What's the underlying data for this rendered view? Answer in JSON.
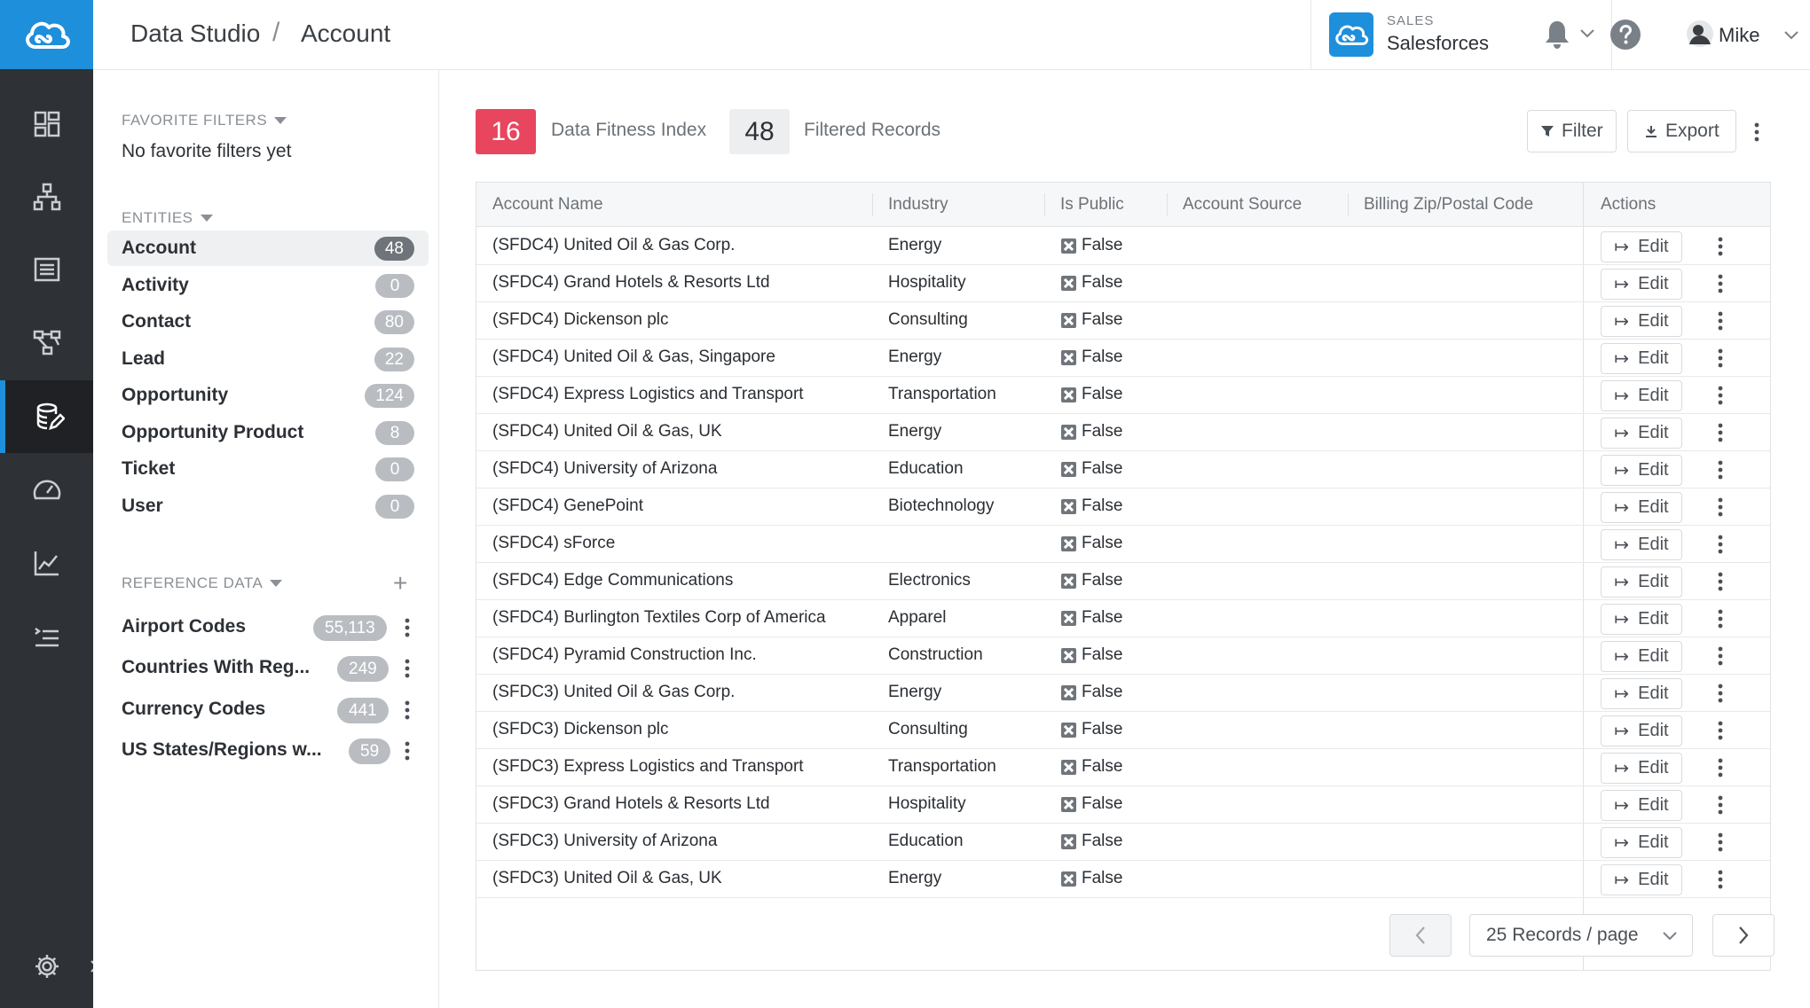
{
  "topbar": {
    "breadcrumb": [
      "Data Studio",
      "Account"
    ],
    "breadcrumb_separator": "/",
    "source": {
      "category": "SALES",
      "name": "Salesforces"
    },
    "user": {
      "name": "Mike"
    }
  },
  "rail": {
    "items": [
      "dashboard-icon",
      "hierarchy-icon",
      "list-icon",
      "flow-icon",
      "data-studio-icon",
      "gauge-icon",
      "chart-icon",
      "tasks-icon"
    ],
    "active": "data-studio-icon"
  },
  "sidebar": {
    "favorite_title": "FAVORITE FILTERS",
    "no_favorites": "No favorite filters yet",
    "entities_title": "ENTITIES",
    "entities": [
      {
        "label": "Account",
        "count": "48"
      },
      {
        "label": "Activity",
        "count": "0"
      },
      {
        "label": "Contact",
        "count": "80"
      },
      {
        "label": "Lead",
        "count": "22"
      },
      {
        "label": "Opportunity",
        "count": "124"
      },
      {
        "label": "Opportunity Product",
        "count": "8"
      },
      {
        "label": "Ticket",
        "count": "0"
      },
      {
        "label": "User",
        "count": "0"
      }
    ],
    "reference_title": "REFERENCE DATA",
    "reference": [
      {
        "label": "Airport Codes",
        "count": "55,113"
      },
      {
        "label": "Countries With Reg...",
        "count": "249"
      },
      {
        "label": "Currency Codes",
        "count": "441"
      },
      {
        "label": "US States/Regions w...",
        "count": "59"
      }
    ]
  },
  "main": {
    "fitness_value": "16",
    "fitness_label": "Data Fitness Index",
    "filtered_value": "48",
    "filtered_label": "Filtered Records",
    "filter_button": "Filter",
    "export_button": "Export",
    "columns": [
      "Account Name",
      "Industry",
      "Is Public",
      "Account Source",
      "Billing Zip/Postal Code",
      "Actions"
    ],
    "edit_label": "Edit",
    "rows": [
      {
        "name": "(SFDC4) United Oil & Gas Corp.",
        "industry": "Energy",
        "is_public": "False"
      },
      {
        "name": "(SFDC4) Grand Hotels & Resorts Ltd",
        "industry": "Hospitality",
        "is_public": "False"
      },
      {
        "name": "(SFDC4) Dickenson plc",
        "industry": "Consulting",
        "is_public": "False"
      },
      {
        "name": "(SFDC4) United Oil & Gas, Singapore",
        "industry": "Energy",
        "is_public": "False"
      },
      {
        "name": "(SFDC4) Express Logistics and Transport",
        "industry": "Transportation",
        "is_public": "False"
      },
      {
        "name": "(SFDC4) United Oil & Gas, UK",
        "industry": "Energy",
        "is_public": "False"
      },
      {
        "name": "(SFDC4) University of Arizona",
        "industry": "Education",
        "is_public": "False"
      },
      {
        "name": "(SFDC4) GenePoint",
        "industry": "Biotechnology",
        "is_public": "False"
      },
      {
        "name": "(SFDC4) sForce",
        "industry": "",
        "is_public": "False"
      },
      {
        "name": "(SFDC4) Edge Communications",
        "industry": "Electronics",
        "is_public": "False"
      },
      {
        "name": "(SFDC4) Burlington Textiles Corp of America",
        "industry": "Apparel",
        "is_public": "False"
      },
      {
        "name": "(SFDC4) Pyramid Construction Inc.",
        "industry": "Construction",
        "is_public": "False"
      },
      {
        "name": "(SFDC3) United Oil & Gas Corp.",
        "industry": "Energy",
        "is_public": "False"
      },
      {
        "name": "(SFDC3) Dickenson plc",
        "industry": "Consulting",
        "is_public": "False"
      },
      {
        "name": "(SFDC3) Express Logistics and Transport",
        "industry": "Transportation",
        "is_public": "False"
      },
      {
        "name": "(SFDC3) Grand Hotels & Resorts Ltd",
        "industry": "Hospitality",
        "is_public": "False"
      },
      {
        "name": "(SFDC3) University of Arizona",
        "industry": "Education",
        "is_public": "False"
      },
      {
        "name": "(SFDC3) United Oil & Gas, UK",
        "industry": "Energy",
        "is_public": "False"
      }
    ],
    "page_size": "25 Records / page"
  },
  "colors": {
    "accent": "#1e8fdb",
    "rail": "#2e3135",
    "fitness_badge": "#e8455f",
    "filtered_badge": "#eceef0"
  }
}
